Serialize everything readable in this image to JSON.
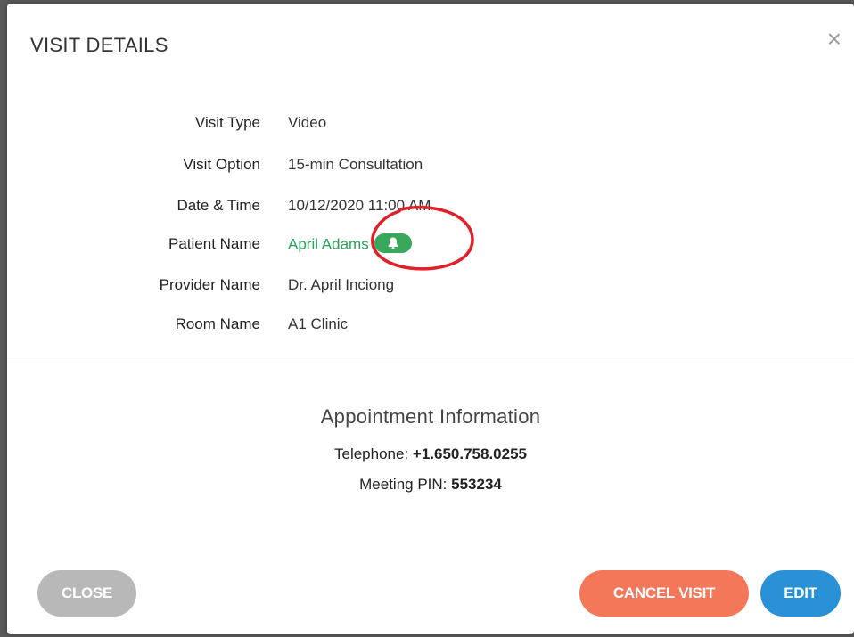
{
  "modal": {
    "title": "VISIT DETAILS",
    "close_glyph": "×"
  },
  "details": {
    "rows": [
      {
        "label": "Visit Type",
        "value": "Video"
      },
      {
        "label": "Visit Option",
        "value": "15-min Consultation"
      },
      {
        "label": "Date & Time",
        "value": "10/12/2020 11:00 AM"
      },
      {
        "label": "Patient Name",
        "value": "April Adams"
      },
      {
        "label": "Provider Name",
        "value": "Dr. April Inciong"
      },
      {
        "label": "Room Name",
        "value": "A1 Clinic"
      }
    ],
    "patient_badge_icon": "bell-icon"
  },
  "appointment": {
    "title": "Appointment Information",
    "telephone_label": "Telephone:",
    "telephone_value": "+1.650.758.0255",
    "pin_label": "Meeting PIN:",
    "pin_value": "553234"
  },
  "buttons": {
    "close": "CLOSE",
    "cancel_visit": "CANCEL VISIT",
    "edit": "EDIT"
  },
  "colors": {
    "patient_link": "#27a35a",
    "badge": "#3aa85c",
    "cancel": "#f4775a",
    "edit": "#2a91d6",
    "close": "#b8b8b8",
    "annotation": "#e0202a"
  }
}
